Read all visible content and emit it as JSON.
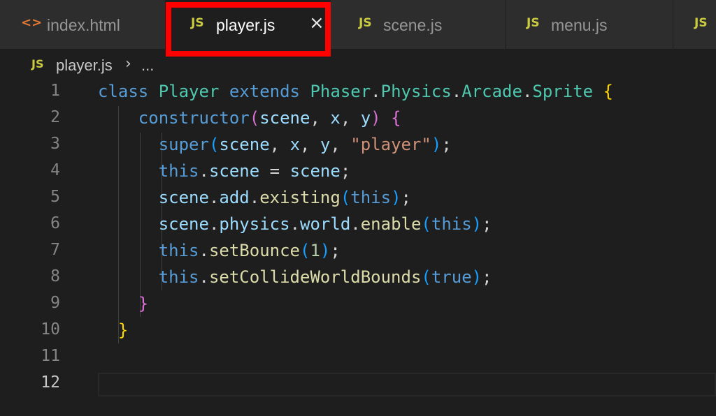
{
  "tabs": [
    {
      "icon": "<>",
      "label": "index.html",
      "active": false
    },
    {
      "icon": "JS",
      "label": "player.js",
      "active": true,
      "close": "×"
    },
    {
      "icon": "JS",
      "label": "scene.js",
      "active": false
    },
    {
      "icon": "JS",
      "label": "menu.js",
      "active": false
    },
    {
      "icon": "JS",
      "label": "",
      "active": false
    }
  ],
  "breadcrumb": {
    "icon": "JS",
    "file": "player.js",
    "separator": "›",
    "more": "..."
  },
  "editor": {
    "line_numbers": [
      "1",
      "2",
      "3",
      "4",
      "5",
      "6",
      "7",
      "8",
      "9",
      "10",
      "11",
      "12"
    ],
    "current_line": "12",
    "code_lines": [
      "class Player extends Phaser.Physics.Arcade.Sprite {",
      "    constructor(scene, x, y) {",
      "      super(scene, x, y, \"player\");",
      "      this.scene = scene;",
      "      scene.add.existing(this);",
      "      scene.physics.world.enable(this);",
      "      this.setBounce(1);",
      "      this.setCollideWorldBounds(true);",
      "    }",
      "  }",
      "",
      ""
    ]
  },
  "colors": {
    "keyword": "#569cd6",
    "class_name": "#4ec9b0",
    "function": "#dcdcaa",
    "variable": "#9cdcfe",
    "string": "#ce9178",
    "number": "#b5cea8",
    "highlight": "#ff0000",
    "js_icon": "#cbcb41",
    "html_icon": "#e37933"
  }
}
